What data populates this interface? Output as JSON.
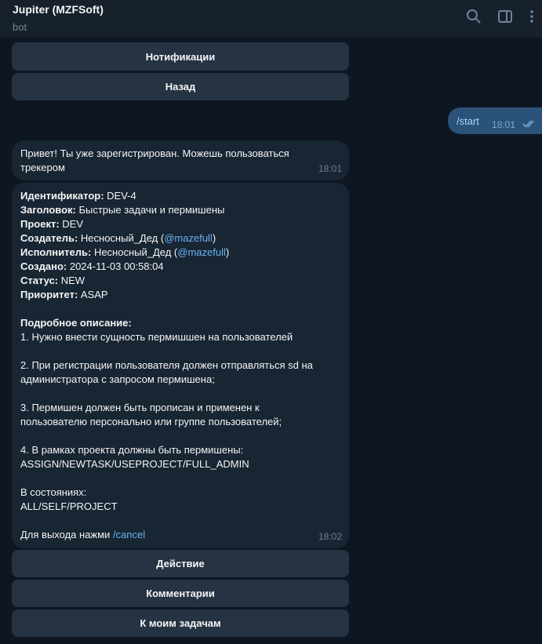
{
  "header": {
    "title": "Jupiter (MZFSoft)",
    "subtitle": "bot",
    "icons": [
      "search-icon",
      "sidebar-toggle-icon",
      "more-icon"
    ]
  },
  "top_keyboard": {
    "notifications": "Нотификации",
    "back": "Назад"
  },
  "outgoing": {
    "text": "/start",
    "time": "18:01",
    "status_icon": "double-check-icon"
  },
  "msg1": {
    "text": "Привет! Ты уже зарегистрирован. Можешь пользоваться трекером",
    "time": "18:01"
  },
  "msg2": {
    "id_label": "Идентификатор:",
    "id_value": " DEV-4",
    "title_label": "Заголовок:",
    "title_value": " Быстрые задачи и пермишены",
    "project_label": "Проект:",
    "project_value": " DEV",
    "creator_label": "Создатель:",
    "creator_name": " Несносный_Дед (",
    "creator_handle": "@mazefull",
    "creator_close": ")",
    "assignee_label": "Исполнитель:",
    "assignee_name": " Несносный_Дед (",
    "assignee_handle": "@mazefull",
    "assignee_close": ")",
    "created_label": "Создано:",
    "created_value": " 2024-11-03 00:58:04",
    "status_label": "Статус:",
    "status_value": " NEW",
    "priority_label": "Приоритет:",
    "priority_value": " ASAP",
    "desc_label": "Подробное описание:",
    "desc_1": "1. Нужно внести сущность пермишшен на пользователей",
    "desc_2a": "2. При регистрации пользователя должен отправляться sd на",
    "desc_2b": "администратора с запросом пермишена;",
    "desc_3a": "3. Пермишен должен быть прописан и применен к",
    "desc_3b": "пользователю персонально или группе пользователей;",
    "desc_4a": "4. В рамках проекта должны быть пермишены:",
    "desc_4b": "ASSIGN/NEWTASK/USEPROJECT/FULL_ADMIN",
    "states_label": "В состояниях:",
    "states_value": "ALL/SELF/PROJECT",
    "exit_text": "Для выхода нажми ",
    "exit_cmd": "/cancel",
    "time": "18:02"
  },
  "bottom_keyboard": {
    "action": "Действие",
    "comments": "Комментарии",
    "my_tasks": "К моим задачам"
  }
}
